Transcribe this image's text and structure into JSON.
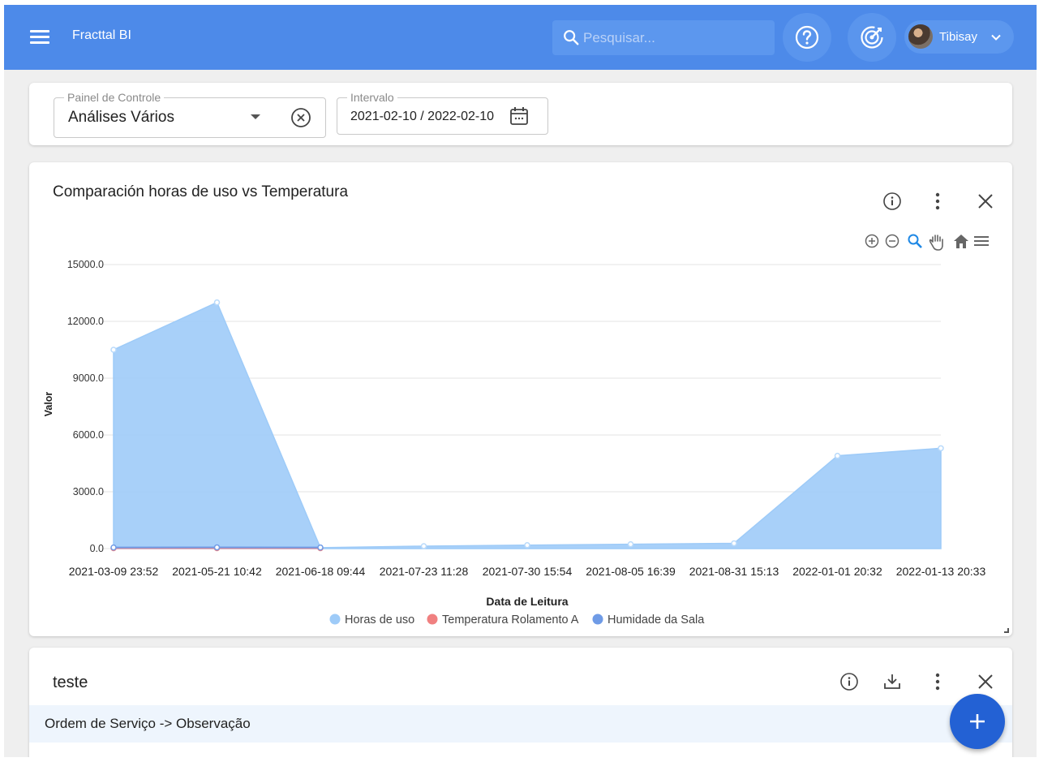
{
  "app": {
    "title": "Fracttal BI"
  },
  "search": {
    "placeholder": "Pesquisar..."
  },
  "user": {
    "name": "Tibisay"
  },
  "filters": {
    "panel": {
      "label": "Painel de Controle",
      "value": "Análises Vários"
    },
    "interval": {
      "label": "Intervalo",
      "value": "2021-02-10 / 2022-02-10"
    }
  },
  "chart_card": {
    "title": "Comparación horas de uso vs Temperatura",
    "icons": [
      "info-icon",
      "more-vert-icon",
      "close-icon"
    ],
    "toolbar_icons": [
      "zoom-in-icon",
      "zoom-out-icon",
      "zoom-select-icon",
      "pan-hand-icon",
      "home-reset-icon",
      "menu-icon"
    ]
  },
  "chart_data": {
    "type": "area",
    "xlabel": "Data de Leitura",
    "ylabel": "Valor",
    "ylim": [
      0,
      15000
    ],
    "yticks": [
      "15000.0",
      "12000.0",
      "9000.0",
      "6000.0",
      "3000.0",
      "0.0"
    ],
    "ytick_values": [
      15000,
      12000,
      9000,
      6000,
      3000,
      0
    ],
    "categories": [
      "2021-03-09 23:52",
      "2021-05-21 10:42",
      "2021-06-18 09:44",
      "2021-07-23 11:28",
      "2021-07-30 15:54",
      "2021-08-05 16:39",
      "2021-08-31 15:13",
      "2022-01-01 20:32",
      "2022-01-13 20:33"
    ],
    "series": [
      {
        "name": "Horas de uso",
        "color": "#9ecbf8",
        "values": [
          10500,
          13000,
          50,
          130,
          180,
          230,
          280,
          4900,
          5300
        ]
      },
      {
        "name": "Temperatura Rolamento A",
        "color": "#f08080",
        "values": [
          20,
          22,
          21,
          null,
          null,
          null,
          null,
          null,
          null
        ]
      },
      {
        "name": "Humidade da Sala",
        "color": "#6f9be6",
        "values": [
          60,
          62,
          58,
          null,
          null,
          null,
          null,
          null,
          null
        ]
      }
    ],
    "legend_position": "bottom",
    "grid": true
  },
  "table_card": {
    "title": "teste",
    "header": "Ordem de Serviço -> Observação",
    "icons": [
      "info-icon",
      "download-icon",
      "more-vert-icon",
      "close-icon"
    ]
  },
  "fab": {
    "icon": "add-icon"
  }
}
